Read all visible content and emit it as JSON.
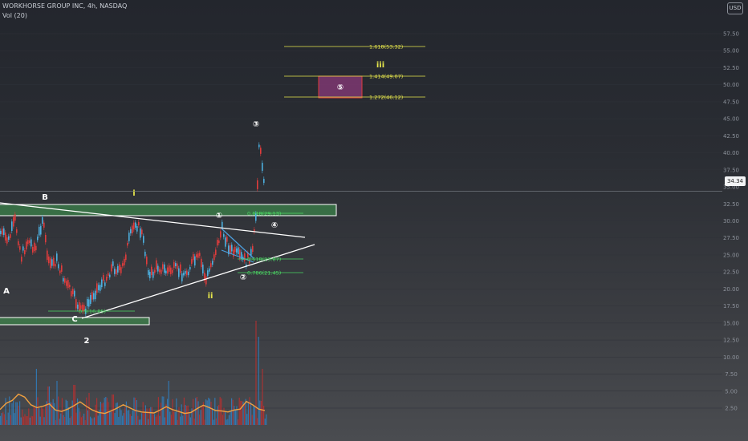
{
  "header": {
    "symbol_line": "WORKHORSE GROUP INC, 4h, NASDAQ",
    "volume_line": "Vol (20)",
    "currency_badge": "USD"
  },
  "chart_data": {
    "type": "line",
    "title": "WORKHORSE GROUP INC, 4h, NASDAQ",
    "y_axis": {
      "ticks": [
        "57.50",
        "55.00",
        "52.50",
        "50.00",
        "47.50",
        "45.00",
        "42.50",
        "40.00",
        "37.50",
        "35.00",
        "32.50",
        "30.00",
        "27.50",
        "25.00",
        "22.50",
        "20.00",
        "17.50",
        "15.00",
        "12.50",
        "10.00",
        "7.50",
        "5.00",
        "2.50"
      ],
      "last_price": "34.34"
    },
    "series": [
      {
        "name": "Vol (20)",
        "values": [
          3.2,
          4.5,
          5.1,
          6.4,
          5.8,
          4.2,
          3.6,
          3.9,
          4.4,
          3.1,
          2.8,
          3.3,
          4.0,
          4.8,
          3.9,
          3.1,
          2.6,
          2.4,
          2.9,
          3.5,
          4.2,
          3.6,
          3.0,
          2.7,
          2.6,
          2.5,
          3.1,
          3.8,
          3.2,
          2.8,
          2.4,
          2.6,
          3.4,
          4.1,
          3.6,
          3.0,
          2.9,
          2.7,
          3.1,
          3.3,
          4.9,
          4.2,
          3.3,
          3.0
        ]
      }
    ],
    "fib_levels": [
      {
        "label": "1.618(53.32)",
        "value": 53.32,
        "color": "#e6e64c"
      },
      {
        "label": "1.414(49.07)",
        "value": 49.07,
        "color": "#e6e64c"
      },
      {
        "label": "1.272(46.12)",
        "value": 46.12,
        "color": "#e6e64c"
      },
      {
        "label": "0.618(29.13)",
        "value": 29.13,
        "color": "#4cd964"
      },
      {
        "label": "0.618(23.87)",
        "value": 23.87,
        "color": "#4cd964"
      },
      {
        "label": "0.786(21.45)",
        "value": 21.45,
        "color": "#4cd964"
      },
      {
        "label": "0.5(16.85)",
        "value": 16.85,
        "color": "#4cd964"
      }
    ],
    "annotations": [
      {
        "label": "B",
        "color": "#ffffff"
      },
      {
        "label": "A",
        "color": "#ffffff"
      },
      {
        "label": "C",
        "color": "#ffffff"
      },
      {
        "label": "2",
        "color": "#ffffff"
      },
      {
        "label": "i",
        "color": "#e6e64c"
      },
      {
        "label": "ii",
        "color": "#e6e64c"
      },
      {
        "label": "iii",
        "color": "#e6e64c"
      },
      {
        "label": "①",
        "color": "#ffffff"
      },
      {
        "label": "②",
        "color": "#ffffff"
      },
      {
        "label": "③",
        "color": "#ffffff"
      },
      {
        "label": "④",
        "color": "#ffffff"
      },
      {
        "label": "⑤",
        "color": "#ffffff"
      }
    ],
    "colors": {
      "up": "#4cb0e0",
      "down": "#e03c3c",
      "zone": "#3f9e50",
      "target_box": "#8a3a7a"
    }
  }
}
